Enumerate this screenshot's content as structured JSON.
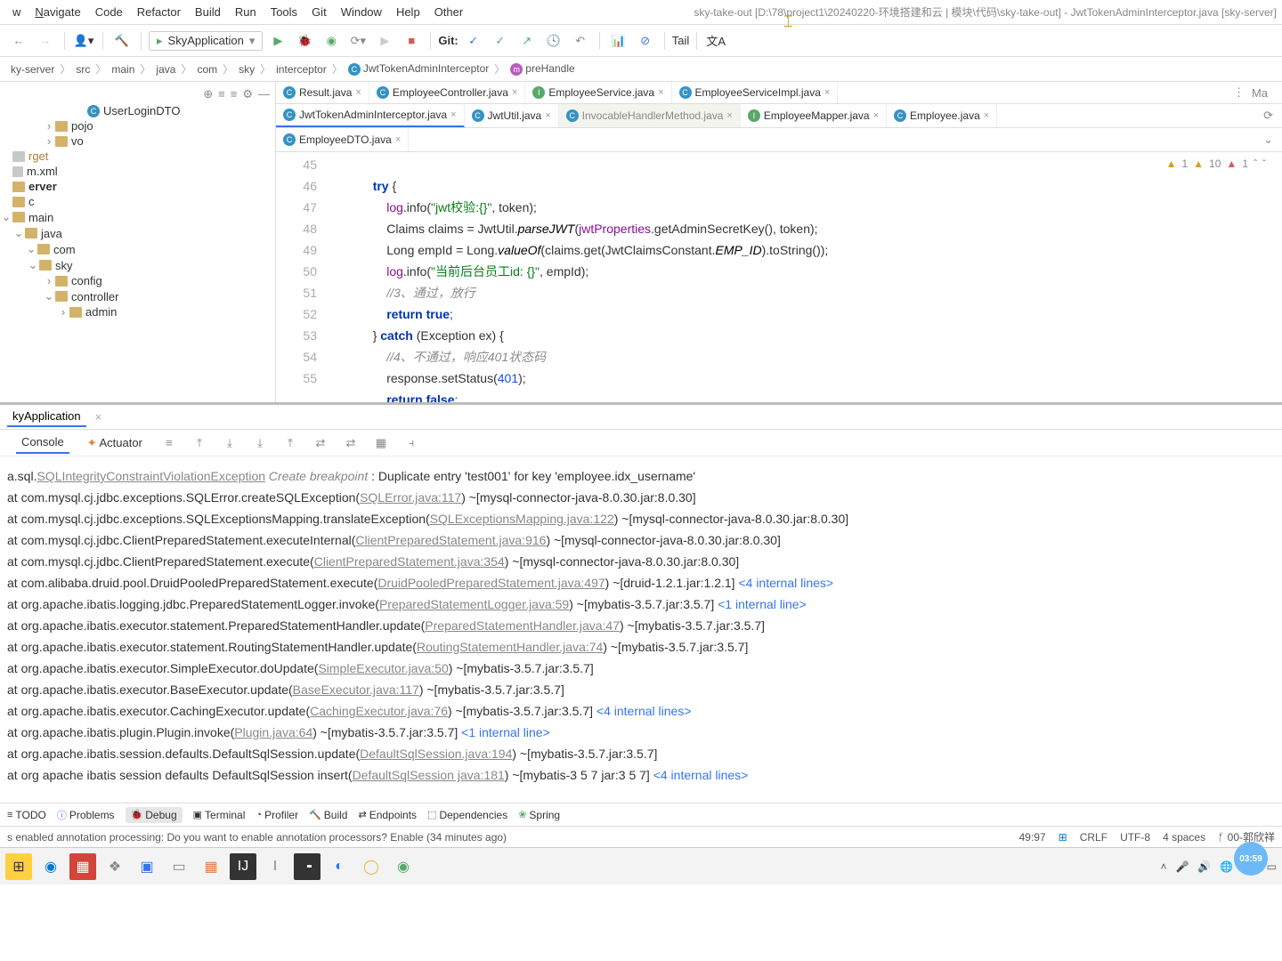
{
  "window": {
    "title": "sky-take-out [D:\\78\\project1\\20240220-环境搭建和云 | 模块\\代码\\sky-take-out] - JwtTokenAdminInterceptor.java [sky-server]"
  },
  "menu": {
    "items": [
      "w",
      "Navigate",
      "Code",
      "Refactor",
      "Build",
      "Run",
      "Tools",
      "Git",
      "Window",
      "Help",
      "Other"
    ]
  },
  "toolbar": {
    "run_config": "SkyApplication",
    "git_label": "Git:",
    "tail_label": "Tail"
  },
  "breadcrumb": {
    "parts": [
      "ky-server",
      "src",
      "main",
      "java",
      "com",
      "sky",
      "interceptor"
    ],
    "class": "JwtTokenAdminInterceptor",
    "method": "preHandle"
  },
  "tree": {
    "items": [
      {
        "indent": 84,
        "type": "class",
        "label": "UserLoginDTO"
      },
      {
        "indent": 48,
        "exp": "›",
        "type": "folder",
        "label": "pojo"
      },
      {
        "indent": 48,
        "exp": "›",
        "type": "folder",
        "label": "vo"
      },
      {
        "indent": 0,
        "type": "folder-gray",
        "label": "rget",
        "color": "#b07d3a"
      },
      {
        "indent": 0,
        "type": "file",
        "label": "m.xml"
      },
      {
        "indent": 0,
        "type": "folder",
        "label": "erver",
        "bold": true
      },
      {
        "indent": 0,
        "type": "folder",
        "label": "c"
      },
      {
        "indent": 0,
        "exp": "⌄",
        "type": "folder",
        "label": "main"
      },
      {
        "indent": 14,
        "exp": "⌄",
        "type": "folder",
        "label": "java"
      },
      {
        "indent": 28,
        "exp": "⌄",
        "type": "folder",
        "label": "com"
      },
      {
        "indent": 30,
        "exp": "⌄",
        "type": "folder",
        "label": "sky"
      },
      {
        "indent": 48,
        "exp": "›",
        "type": "folder",
        "label": "config"
      },
      {
        "indent": 48,
        "exp": "⌄",
        "type": "folder",
        "label": "controller"
      },
      {
        "indent": 64,
        "exp": "›",
        "type": "folder",
        "label": "admin"
      }
    ]
  },
  "editor_tabs": {
    "row1": [
      {
        "ic": "c",
        "label": "Result.java",
        "close": true
      },
      {
        "ic": "c",
        "label": "EmployeeController.java",
        "close": true
      },
      {
        "ic": "i",
        "label": "EmployeeService.java",
        "close": true
      },
      {
        "ic": "c",
        "label": "EmployeeServiceImpl.java",
        "close": true
      }
    ],
    "row2": [
      {
        "ic": "c",
        "label": "JwtTokenAdminInterceptor.java",
        "close": true,
        "active": true
      },
      {
        "ic": "c",
        "label": "JwtUtil.java",
        "close": true
      },
      {
        "ic": "c",
        "label": "InvocableHandlerMethod.java",
        "dim": true,
        "close": true
      },
      {
        "ic": "i",
        "label": "EmployeeMapper.java",
        "close": true
      },
      {
        "ic": "c",
        "label": "Employee.java",
        "close": true
      }
    ],
    "row3": [
      {
        "ic": "c",
        "label": "EmployeeDTO.java",
        "close": true
      }
    ],
    "right_label": "Ma"
  },
  "code": {
    "gutter": [
      "45",
      "46",
      "47",
      "48",
      "49",
      "50",
      "51",
      "52",
      "53",
      "54",
      "55"
    ],
    "hints": {
      "a1": "1",
      "w10": "10",
      "a1b": "1"
    },
    "lines": {
      "l45a": "try",
      "l45b": " {",
      "l46a": "log",
      "l46b": ".info(",
      "l46c": "\"jwt校验:{}\"",
      "l46d": ", token);",
      "l47a": "Claims claims = JwtUtil.",
      "l47b": "parseJWT",
      "l47c": "(",
      "l47d": "jwtProperties",
      "l47e": ".getAdminSecretKey(), token);",
      "l48a": "Long empId = Long.",
      "l48b": "valueOf",
      "l48c": "(claims.get(JwtClaimsConstant.",
      "l48d": "EMP_ID",
      "l48e": ").toString());",
      "l49a": "log",
      "l49b": ".info(",
      "l49c": "\"当前后台员工id: {}\"",
      "l49d": ", empId);",
      "l50": "//3、通过，放行",
      "l51a": "return ",
      "l51b": "true",
      "l51c": ";",
      "l52a": "} ",
      "l52b": "catch",
      "l52c": " (Exception ex) {",
      "l53": "//4、不通过，响应401状态码",
      "l54a": "response.setStatus(",
      "l54b": "401",
      "l54c": ");",
      "l55a": "return ",
      "l55b": "false",
      "l55c": ";"
    }
  },
  "run": {
    "title": "kyApplication",
    "tab_console": "Console",
    "tab_actuator": "Actuator"
  },
  "console": {
    "lines": [
      {
        "pre": "a.sql.",
        "link": "SQLIntegrityConstraintViolationException",
        "bp": " Create breakpoint ",
        "post": ": Duplicate entry 'test001' for key 'employee.idx_username'"
      },
      {
        "pre": "  at com.mysql.cj.jdbc.exceptions.SQLError.createSQLException(",
        "link": "SQLError.java:117",
        "post": ") ~[mysql-connector-java-8.0.30.jar:8.0.30]"
      },
      {
        "pre": "  at com.mysql.cj.jdbc.exceptions.SQLExceptionsMapping.translateException(",
        "link": "SQLExceptionsMapping.java:122",
        "post": ") ~[mysql-connector-java-8.0.30.jar:8.0.30]"
      },
      {
        "pre": "  at com.mysql.cj.jdbc.ClientPreparedStatement.executeInternal(",
        "link": "ClientPreparedStatement.java:916",
        "post": ") ~[mysql-connector-java-8.0.30.jar:8.0.30]"
      },
      {
        "pre": "  at com.mysql.cj.jdbc.ClientPreparedStatement.execute(",
        "link": "ClientPreparedStatement.java:354",
        "post": ") ~[mysql-connector-java-8.0.30.jar:8.0.30]"
      },
      {
        "pre": "  at com.alibaba.druid.pool.DruidPooledPreparedStatement.execute(",
        "link": "DruidPooledPreparedStatement.java:497",
        "post": ") ~[druid-1.2.1.jar:1.2.1] ",
        "blue": "<4 internal lines>"
      },
      {
        "pre": "  at org.apache.ibatis.logging.jdbc.PreparedStatementLogger.invoke(",
        "link": "PreparedStatementLogger.java:59",
        "post": ") ~[mybatis-3.5.7.jar:3.5.7] ",
        "blue": "<1 internal line>"
      },
      {
        "pre": "  at org.apache.ibatis.executor.statement.PreparedStatementHandler.update(",
        "link": "PreparedStatementHandler.java:47",
        "post": ") ~[mybatis-3.5.7.jar:3.5.7]"
      },
      {
        "pre": "  at org.apache.ibatis.executor.statement.RoutingStatementHandler.update(",
        "link": "RoutingStatementHandler.java:74",
        "post": ") ~[mybatis-3.5.7.jar:3.5.7]"
      },
      {
        "pre": "  at org.apache.ibatis.executor.SimpleExecutor.doUpdate(",
        "link": "SimpleExecutor.java:50",
        "post": ") ~[mybatis-3.5.7.jar:3.5.7]"
      },
      {
        "pre": "  at org.apache.ibatis.executor.BaseExecutor.update(",
        "link": "BaseExecutor.java:117",
        "post": ") ~[mybatis-3.5.7.jar:3.5.7]"
      },
      {
        "pre": "  at org.apache.ibatis.executor.CachingExecutor.update(",
        "link": "CachingExecutor.java:76",
        "post": ") ~[mybatis-3.5.7.jar:3.5.7] ",
        "blue": "<4 internal lines>"
      },
      {
        "pre": "  at org.apache.ibatis.plugin.Plugin.invoke(",
        "link": "Plugin.java:64",
        "post": ") ~[mybatis-3.5.7.jar:3.5.7] ",
        "blue": "<1 internal line>"
      },
      {
        "pre": "  at org.apache.ibatis.session.defaults.DefaultSqlSession.update(",
        "link": "DefaultSqlSession.java:194",
        "post": ") ~[mybatis-3.5.7.jar:3.5.7]"
      },
      {
        "pre": "  at org apache ibatis session defaults DefaultSqlSession insert(",
        "link": "DefaultSqlSession java:181",
        "post": ") ~[mybatis-3 5 7 jar:3 5 7] ",
        "blue": "<4 internal lines>"
      }
    ]
  },
  "bottom_tools": {
    "items": [
      "TODO",
      "Problems",
      "Debug",
      "Terminal",
      "Profiler",
      "Build",
      "Endpoints",
      "Dependencies",
      "Spring"
    ]
  },
  "status": {
    "msg": "s enabled annotation processing: Do you want to enable annotation processors? Enable (34 minutes ago)",
    "pos": "49:97",
    "eol": "CRLF",
    "enc": "UTF-8",
    "indent": "4 spaces",
    "branch": "00-郭欣祥"
  },
  "time_badge": "03:59",
  "taskbar": {
    "tray_time": ""
  }
}
